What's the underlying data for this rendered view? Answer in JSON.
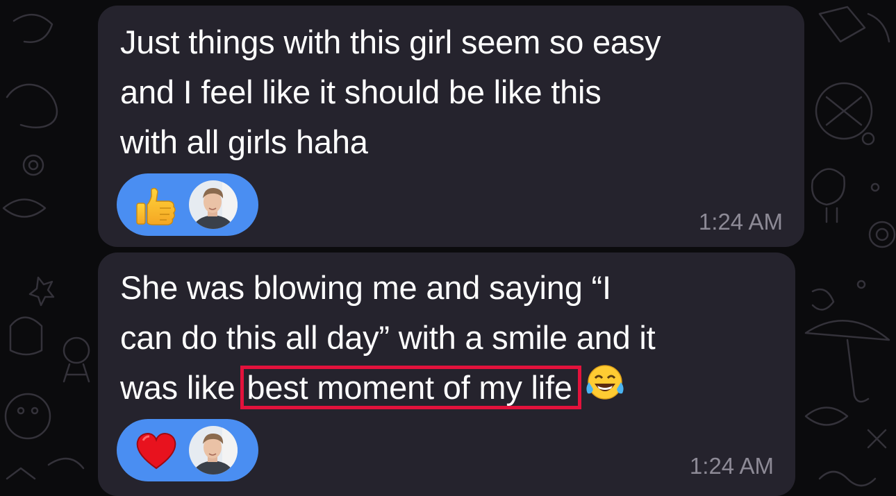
{
  "messages": [
    {
      "lines": [
        "Just things with this girl seem so easy",
        "and I feel like it should be like this",
        "with all girls haha"
      ],
      "reaction": {
        "emoji": "thumbs-up-icon",
        "reactor": "avatar"
      },
      "time": "1:24 AM"
    },
    {
      "lines": [
        "She was blowing me and saying “I",
        "can do this all day” with a smile and it",
        "was like "
      ],
      "highlight": "best moment of my life",
      "trailing_emoji": "tears-of-joy-icon",
      "reaction": {
        "emoji": "heart-icon",
        "reactor": "avatar"
      },
      "time": "1:24 AM"
    }
  ],
  "colors": {
    "background": "#0b0b0d",
    "bubble": "#25232d",
    "reaction_pill": "#4a8ef2",
    "highlight_box": "#e3123c",
    "timestamp": "#8d8a96"
  }
}
